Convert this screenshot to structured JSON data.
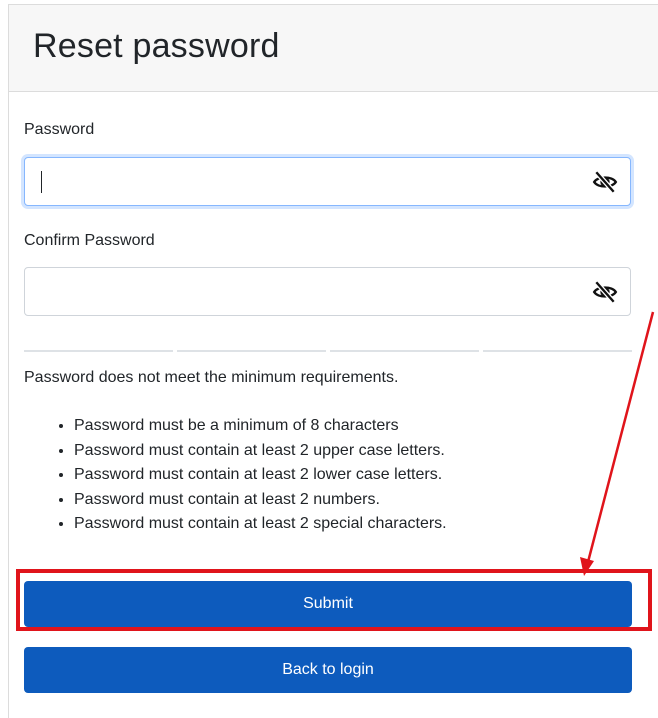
{
  "header": {
    "title": "Reset password"
  },
  "form": {
    "password_label": "Password",
    "password_value": "",
    "confirm_label": "Confirm Password",
    "confirm_value": "",
    "warning": "Password does not meet the minimum requirements.",
    "requirements": [
      "Password must be a minimum of 8 characters",
      "Password must contain at least 2 upper case letters.",
      "Password must contain at least 2 lower case letters.",
      "Password must contain at least 2 numbers.",
      "Password must contain at least 2 special characters."
    ]
  },
  "buttons": {
    "submit": "Submit",
    "back": "Back to login"
  },
  "colors": {
    "primary": "#0d5bbd",
    "annotation": "#e0141b",
    "focus": "#86b7fe"
  },
  "icons": {
    "visibility_toggle": "eye-slash-icon"
  }
}
